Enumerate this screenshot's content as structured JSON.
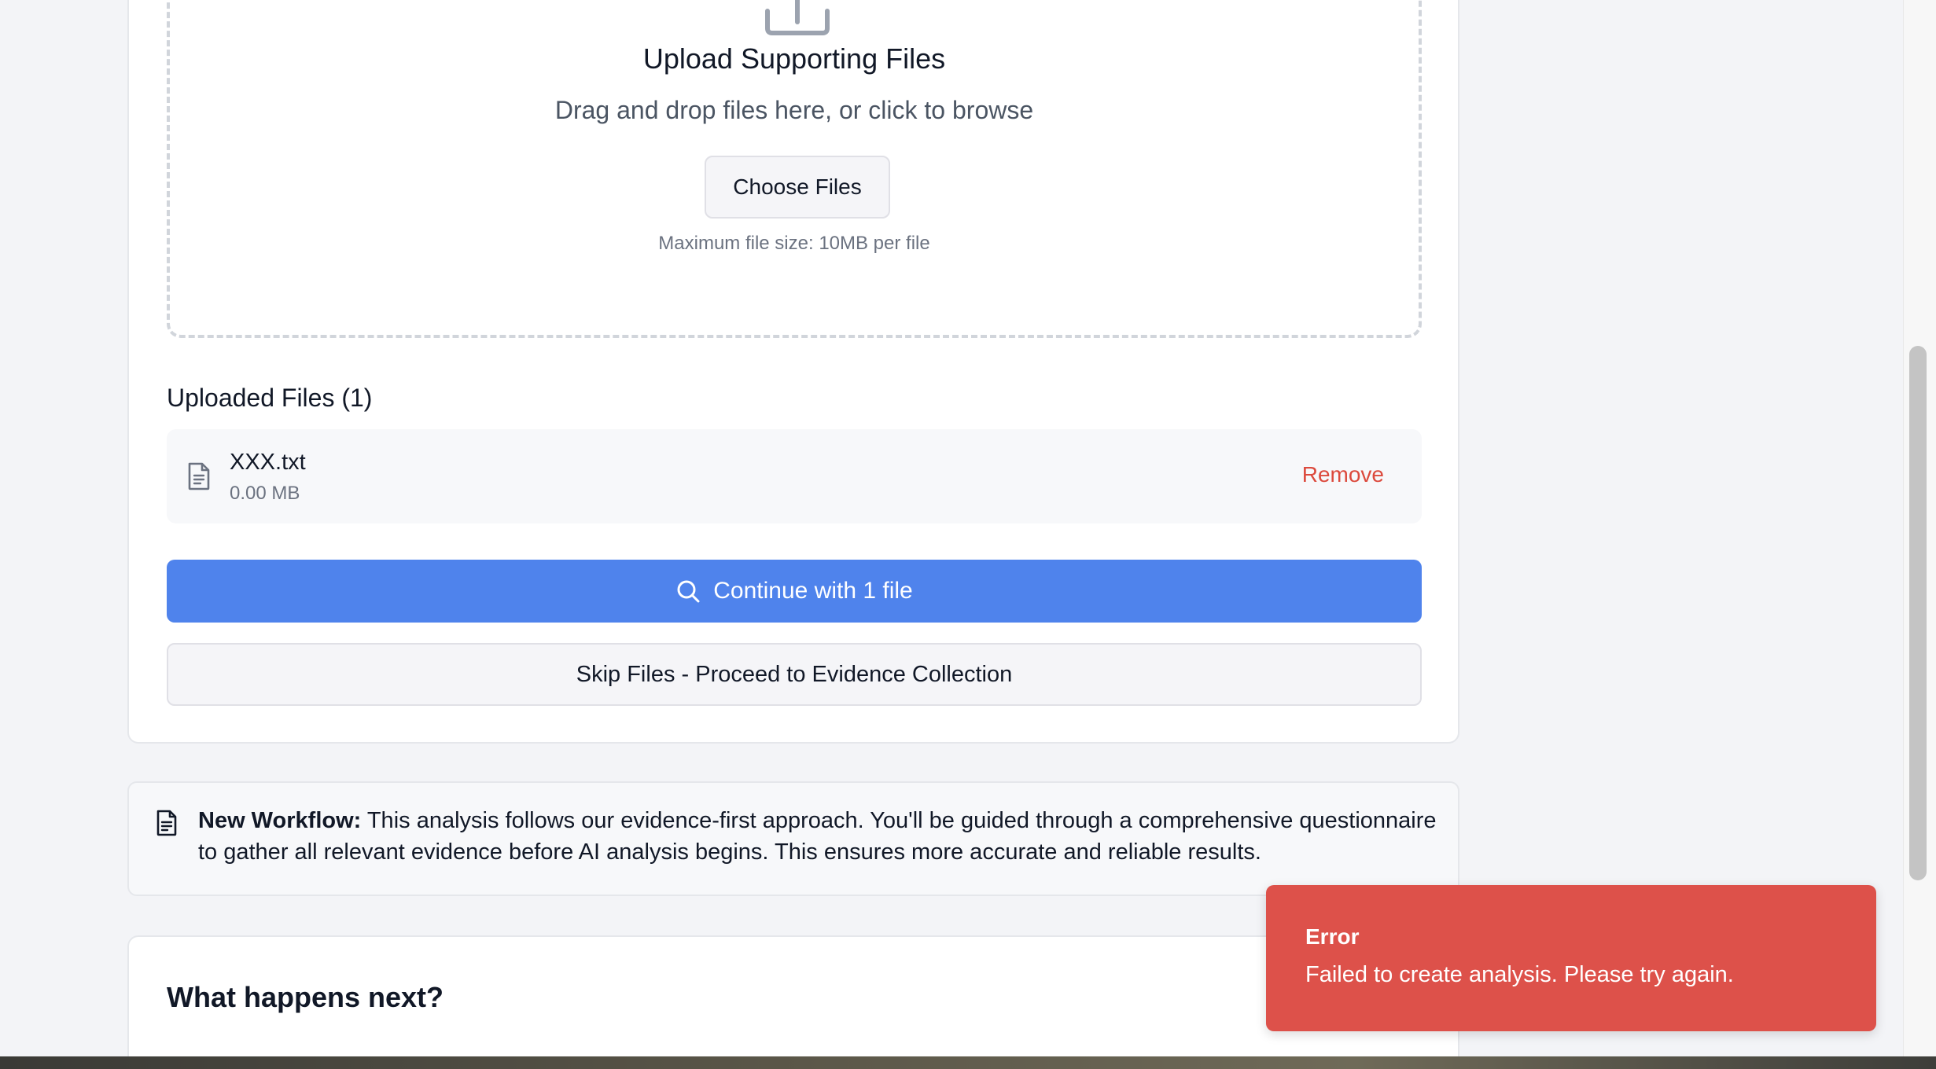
{
  "upload": {
    "title": "Upload Supporting Files",
    "subtitle": "Drag and drop files here, or click to browse",
    "choose_label": "Choose Files",
    "note": "Maximum file size: 10MB per file"
  },
  "uploaded": {
    "heading": "Uploaded Files (1)",
    "files": [
      {
        "name": "XXX.txt",
        "size": "0.00 MB",
        "remove_label": "Remove"
      }
    ]
  },
  "actions": {
    "continue_label": "Continue with 1 file",
    "skip_label": "Skip Files - Proceed to Evidence Collection"
  },
  "info": {
    "bold": "New Workflow:",
    "text": " This analysis follows our evidence-first approach. You'll be guided through a comprehensive questionnaire to gather all relevant evidence before AI analysis begins. This ensures more accurate and reliable results."
  },
  "next": {
    "title": "What happens next?"
  },
  "toast": {
    "title": "Error",
    "message": "Failed to create analysis. Please try again."
  },
  "colors": {
    "primary": "#4f83ec",
    "danger": "#dc4a3d",
    "toast_bg": "#dd514a"
  }
}
